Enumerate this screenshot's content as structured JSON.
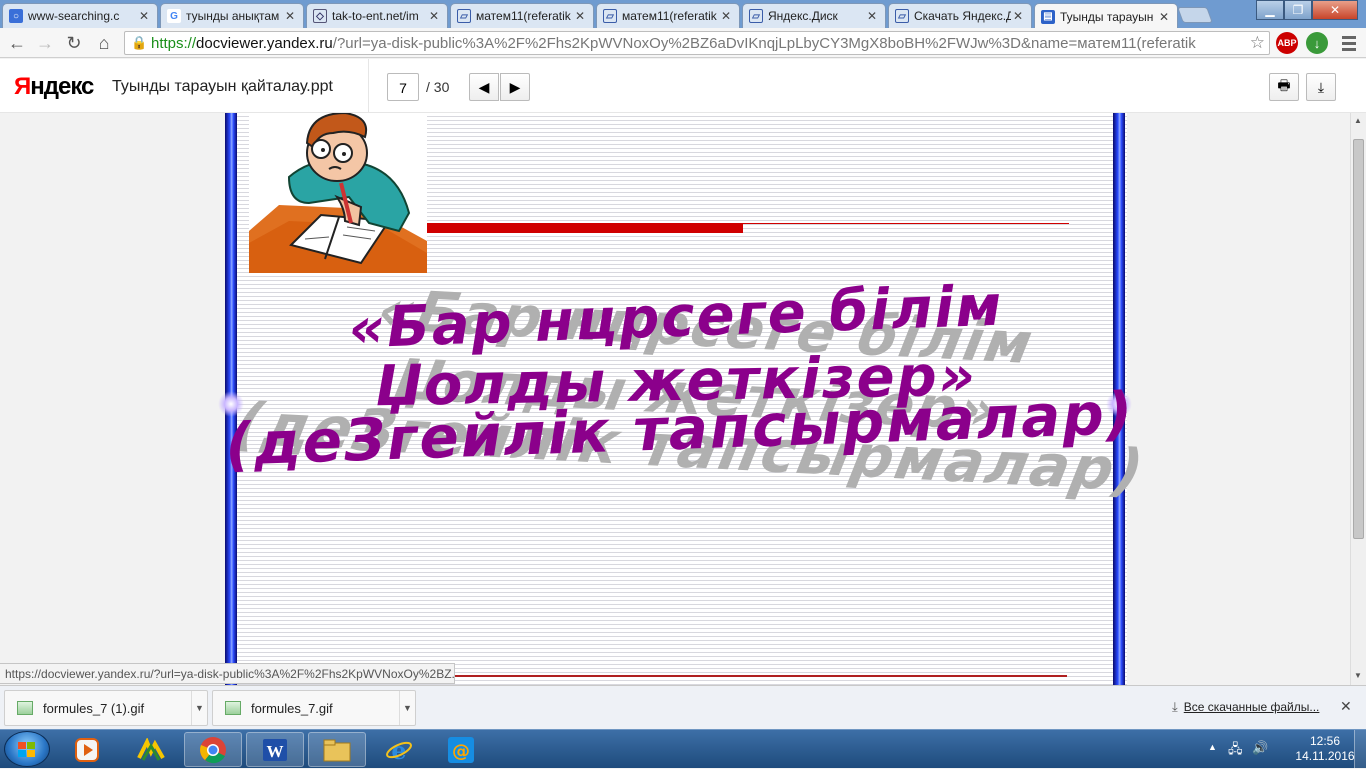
{
  "browser": {
    "tabs": [
      {
        "title": "www-searching.c",
        "favicon": "search-favicon"
      },
      {
        "title": "туынды анықтам",
        "favicon": "google-favicon"
      },
      {
        "title": "tak-to-ent.net/im",
        "favicon": "cube-favicon"
      },
      {
        "title": "матем11(referatik",
        "favicon": "yadisk-favicon"
      },
      {
        "title": "матем11(referatik",
        "favicon": "yadisk-favicon"
      },
      {
        "title": "Яндекс.Диск",
        "favicon": "yadisk-favicon"
      },
      {
        "title": "Скачать Яндекс.Д",
        "favicon": "yadisk-favicon"
      },
      {
        "title": "Туынды тарауын",
        "favicon": "docviewer-favicon"
      }
    ],
    "url_scheme": "https://",
    "url_host": "docviewer.yandex.ru",
    "url_rest": "/?url=ya-disk-public%3A%2F%2Fhs2KpWVNoxOy%2BZ6aDvIKnqjLpLbyCY3MgX8boBH%2FWJw%3D&name=матем11(referatik",
    "ext_abp": "ABP"
  },
  "viewer": {
    "logo_first": "Я",
    "logo_rest": "ндекс",
    "doc_name": "Туынды тарауын қайталау.ppt",
    "page_current": "7",
    "page_total": "/ 30"
  },
  "slide": {
    "line1": "«Бар нцрсеге білім",
    "line2": "Џолды жеткізер»",
    "line3": "(деЗгейлік тапсырмалар)"
  },
  "status_url": "https://docviewer.yandex.ru/?url=ya-disk-public%3A%2F%2Fhs2KpWVNoxOy%2BZ...",
  "downloads": {
    "items": [
      "formules_7 (1).gif",
      "formules_7.gif"
    ],
    "all_label": "Все скачанные файлы..."
  },
  "taskbar": {
    "time": "12:56",
    "date": "14.11.2016"
  },
  "colors": {
    "wordart": "#8b008b",
    "accent_red": "#d00000",
    "border_blue": "#2b4cff"
  }
}
